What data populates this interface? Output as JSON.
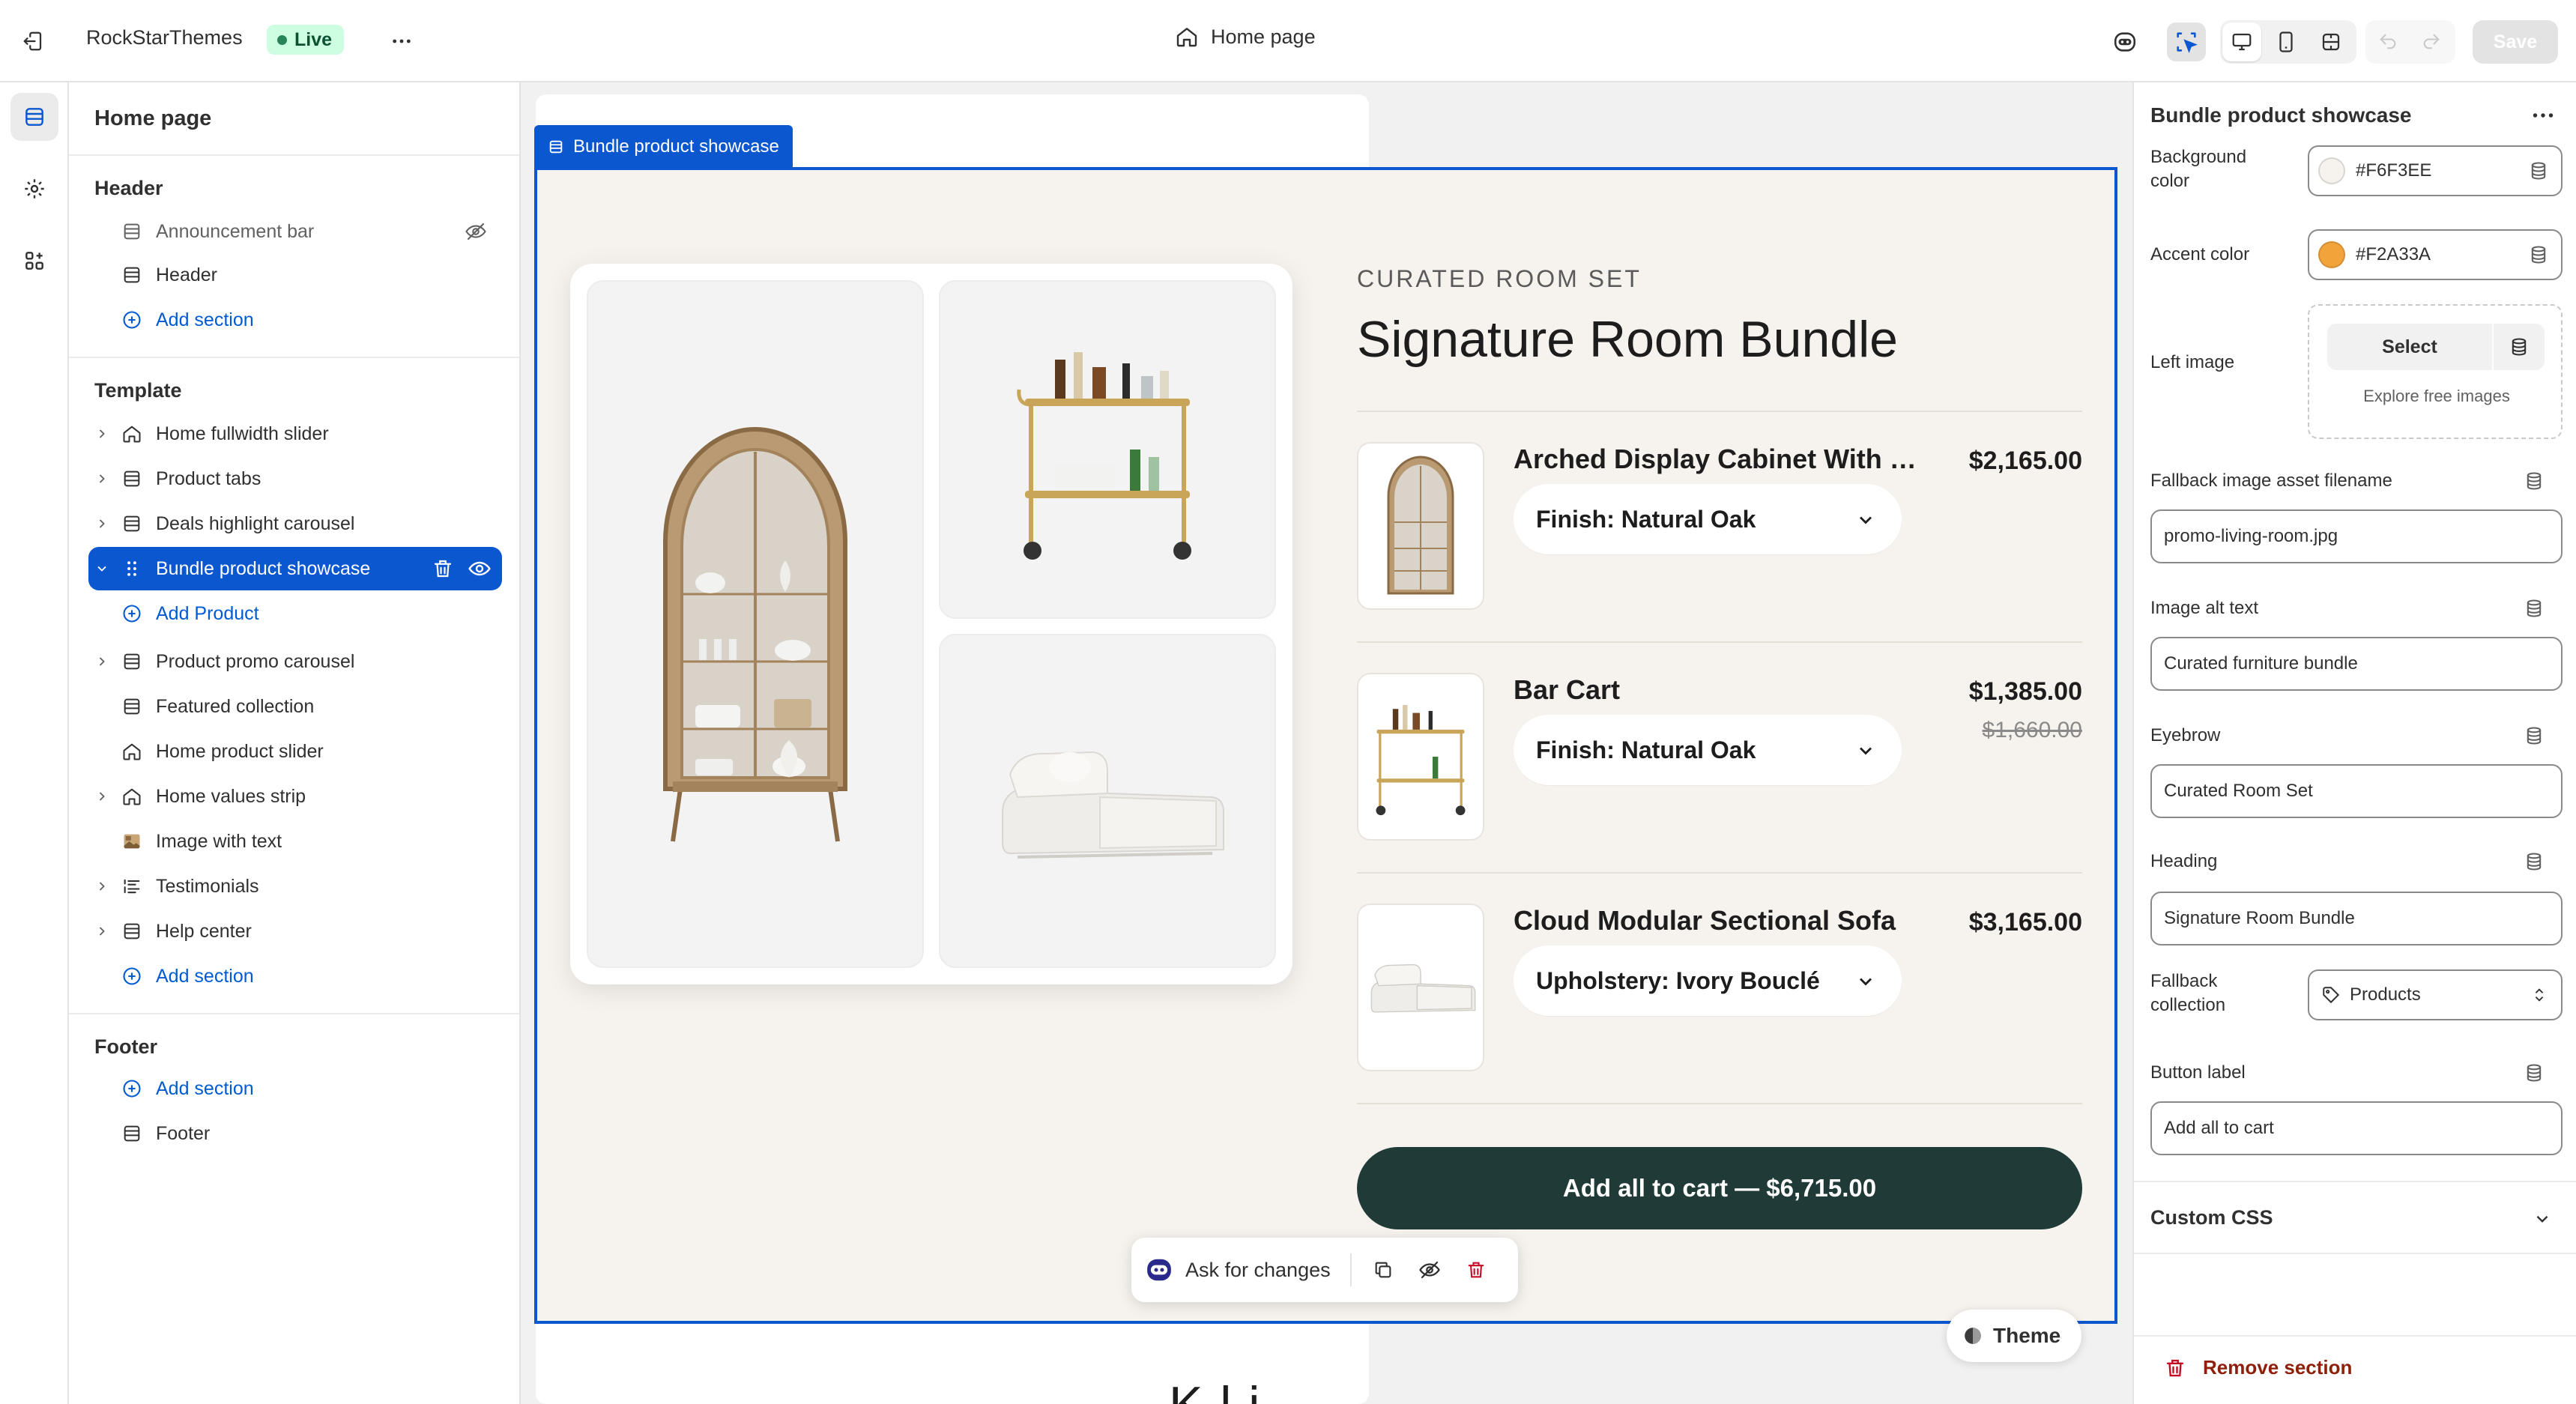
{
  "topbar": {
    "store_name": "RockStarThemes",
    "status_badge": "Live",
    "page_name": "Home page",
    "save_label": "Save"
  },
  "sidebar": {
    "title": "Home page",
    "header_group": "Header",
    "header_items": [
      {
        "label": "Announcement bar",
        "icon": "section-icon",
        "hidden": true
      },
      {
        "label": "Header",
        "icon": "section-icon"
      }
    ],
    "add_section": "Add section",
    "template_group": "Template",
    "template_items": [
      {
        "label": "Home fullwidth slider",
        "icon": "home-icon",
        "expandable": true
      },
      {
        "label": "Product tabs",
        "icon": "section-icon",
        "expandable": true
      },
      {
        "label": "Deals highlight carousel",
        "icon": "section-icon",
        "expandable": true
      },
      {
        "label": "Bundle product showcase",
        "icon": "section-icon",
        "expandable": true,
        "selected": true
      },
      {
        "label": "Add Product",
        "icon": "plus-circle-icon",
        "child": true
      },
      {
        "label": "Product promo carousel",
        "icon": "section-icon",
        "expandable": true
      },
      {
        "label": "Featured collection",
        "icon": "section-icon"
      },
      {
        "label": "Home product slider",
        "icon": "home-icon"
      },
      {
        "label": "Home values strip",
        "icon": "home-icon",
        "expandable": true
      },
      {
        "label": "Image with text",
        "icon": "image-icon"
      },
      {
        "label": "Testimonials",
        "icon": "list-icon",
        "expandable": true
      },
      {
        "label": "Help center",
        "icon": "section-icon",
        "expandable": true
      }
    ],
    "footer_group": "Footer",
    "footer_items": [
      {
        "label": "Footer",
        "icon": "section-icon"
      }
    ]
  },
  "preview": {
    "section_badge": "Bundle product showcase",
    "eyebrow": "CURATED ROOM SET",
    "heading": "Signature Room Bundle",
    "products": [
      {
        "name": "Arched Display Cabinet With Rib...",
        "price": "$2,165.00",
        "variant": "Finish: Natural Oak"
      },
      {
        "name": "Bar Cart",
        "price": "$1,385.00",
        "compare_price": "$1,660.00",
        "variant": "Finish: Natural Oak"
      },
      {
        "name": "Cloud Modular Sectional Sofa",
        "price": "$3,165.00",
        "variant": "Upholstery: Ivory Bouclé"
      }
    ],
    "cart_button": "Add all to cart — $6,715.00",
    "ask_label": "Ask for changes",
    "theme_label": "Theme",
    "next_heading": "K    l   i"
  },
  "settings": {
    "title": "Bundle product showcase",
    "background_color_label": "Background color",
    "background_color": "#F6F3EE",
    "accent_color_label": "Accent color",
    "accent_color": "#F2A33A",
    "left_image_label": "Left image",
    "select_label": "Select",
    "explore_label": "Explore free images",
    "fallback_filename_label": "Fallback image asset filename",
    "fallback_filename": "promo-living-room.jpg",
    "alt_text_label": "Image alt text",
    "alt_text": "Curated furniture bundle",
    "eyebrow_label": "Eyebrow",
    "eyebrow_value": "Curated Room Set",
    "heading_label": "Heading",
    "heading_value": "Signature Room Bundle",
    "fallback_collection_label": "Fallback collection",
    "fallback_collection": "Products",
    "button_label_label": "Button label",
    "button_label_value": "Add all to cart",
    "custom_css_label": "Custom CSS",
    "remove_label": "Remove section"
  },
  "colors": {
    "accent_blue": "#0B57D0",
    "section_bg": "#F6F3EE",
    "cart_button": "#1F3A37",
    "remove_red": "#8E1F0B"
  }
}
